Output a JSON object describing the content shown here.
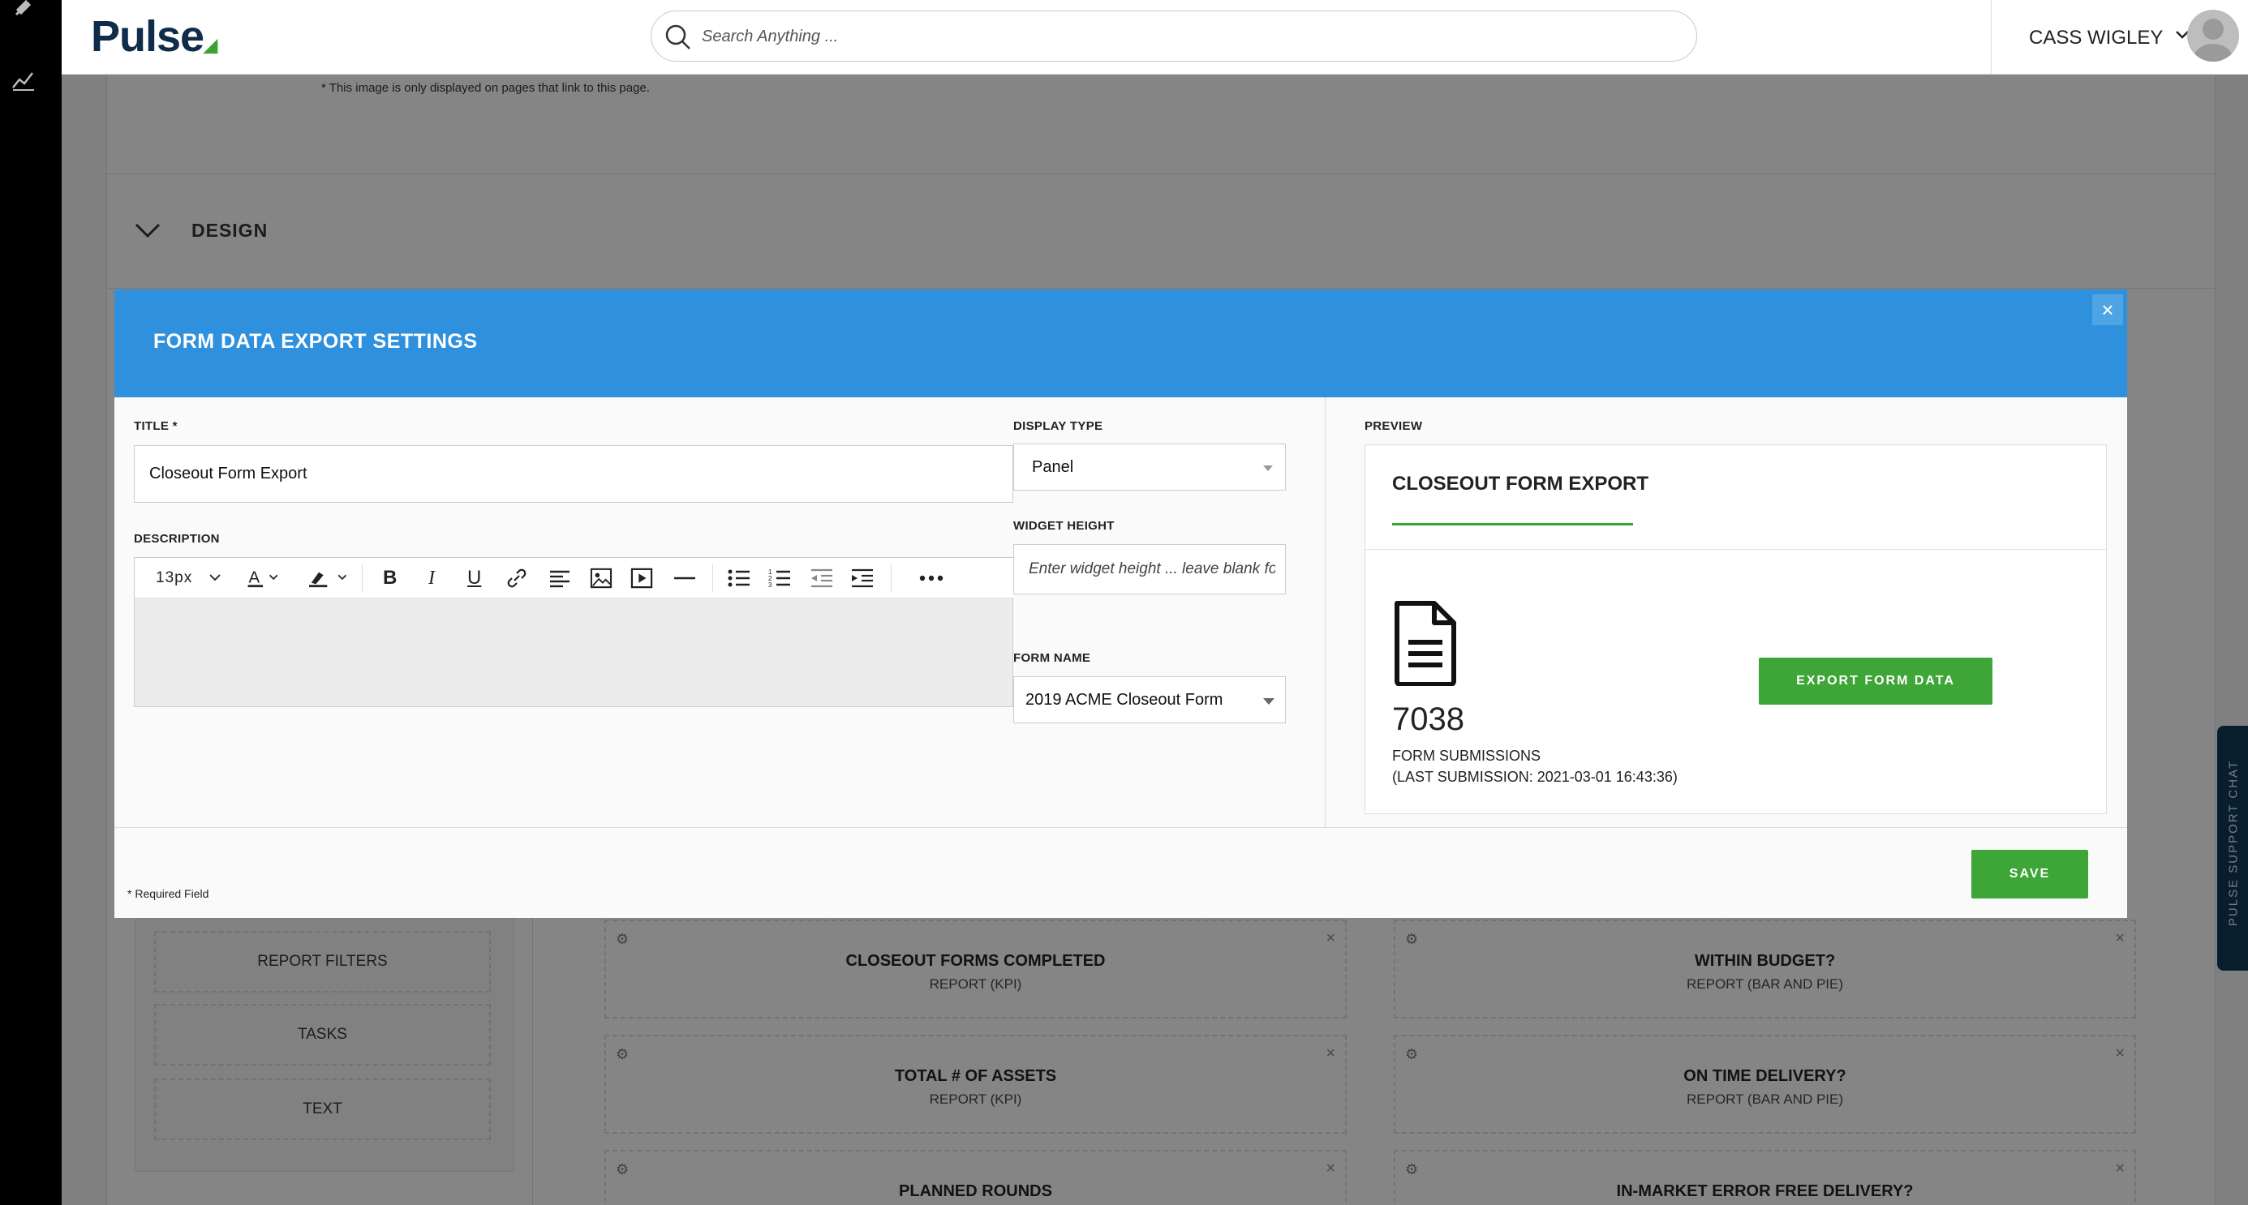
{
  "app": {
    "brand": "Pulse",
    "search_placeholder": "Search Anything ...",
    "user_name": "CASS WIGLEY"
  },
  "background": {
    "image_note": "* This image is only displayed on pages that link to this page.",
    "design_label": "DESIGN",
    "side_items": [
      "REPORT FILTERS",
      "TASKS",
      "TEXT"
    ],
    "cards": [
      {
        "title": "CLOSEOUT FORMS COMPLETED",
        "subtitle": "REPORT (KPI)"
      },
      {
        "title": "WITHIN BUDGET?",
        "subtitle": "REPORT (BAR AND PIE)"
      },
      {
        "title": "TOTAL # OF ASSETS",
        "subtitle": "REPORT (KPI)"
      },
      {
        "title": "ON TIME DELIVERY?",
        "subtitle": "REPORT (BAR AND PIE)"
      },
      {
        "title": "PLANNED ROUNDS",
        "subtitle": ""
      },
      {
        "title": "IN-MARKET ERROR FREE DELIVERY?",
        "subtitle": ""
      }
    ],
    "support_tab": "PULSE SUPPORT CHAT"
  },
  "modal": {
    "title": "FORM DATA EXPORT SETTINGS",
    "close": "×",
    "title_label": "TITLE *",
    "title_value": "Closeout Form Export",
    "description_label": "DESCRIPTION",
    "font_size": "13px",
    "display_type_label": "DISPLAY TYPE",
    "display_type_value": "Panel",
    "widget_height_label": "WIDGET HEIGHT",
    "widget_height_placeholder": "Enter widget height ... leave blank for auto",
    "form_name_label": "FORM NAME",
    "form_name_value": "2019 ACME Closeout Form",
    "preview_label": "PREVIEW",
    "preview": {
      "title": "CLOSEOUT FORM EXPORT",
      "count": "7038",
      "count_label": "FORM SUBMISSIONS",
      "last_submission": "(LAST SUBMISSION: 2021-03-01 16:43:36)",
      "export_button": "EXPORT FORM DATA"
    },
    "required_note": "* Required Field",
    "save_button": "SAVE"
  },
  "colors": {
    "header_blue": "#2f91dd",
    "accent_green": "#3ea537",
    "brand_navy": "#0f2c4a"
  },
  "icons": [
    "pin-icon",
    "chart-icon",
    "search-icon",
    "chevron-down-icon",
    "close-icon",
    "file-icon",
    "settings-icon"
  ]
}
